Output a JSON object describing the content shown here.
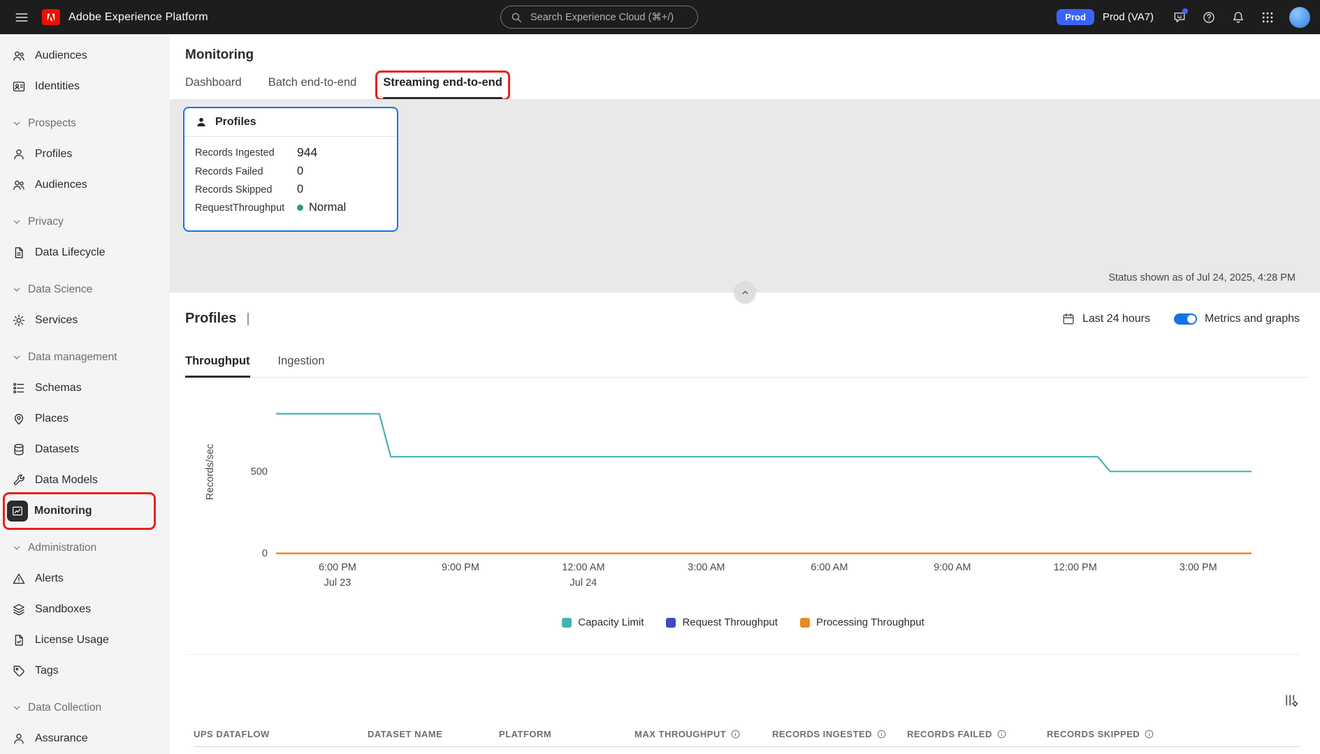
{
  "topbar": {
    "app_title": "Adobe Experience Platform",
    "search_placeholder": "Search Experience Cloud (⌘+/)",
    "env_badge": "Prod",
    "env_label": "Prod (VA7)",
    "icon_buttons": [
      {
        "icon": "feedback-icon",
        "dot": true
      },
      {
        "icon": "help-icon"
      },
      {
        "icon": "bell-icon"
      },
      {
        "icon": "apps-grid-icon"
      }
    ]
  },
  "colors": {
    "accent_blue": "#1473e6",
    "badge_blue": "#3b63fb",
    "annotation_red": "#e5231b",
    "status_green": "#2d9d78"
  },
  "sidebar": {
    "items": [
      {
        "label": "Audiences",
        "icon": "people-icon"
      },
      {
        "label": "Identities",
        "icon": "identity-icon"
      },
      {
        "label": "Prospects",
        "type": "section"
      },
      {
        "label": "Profiles",
        "icon": "person-icon"
      },
      {
        "label": "Audiences",
        "icon": "people-icon"
      },
      {
        "label": "Privacy",
        "type": "section"
      },
      {
        "label": "Data Lifecycle",
        "icon": "doc-lifecycle-icon"
      },
      {
        "label": "Data Science",
        "type": "section"
      },
      {
        "label": "Services",
        "icon": "services-icon"
      },
      {
        "label": "Data management",
        "type": "section"
      },
      {
        "label": "Schemas",
        "icon": "schemas-icon"
      },
      {
        "label": "Places",
        "icon": "location-pin-icon"
      },
      {
        "label": "Datasets",
        "icon": "database-icon"
      },
      {
        "label": "Data Models",
        "icon": "wrench-icon"
      },
      {
        "label": "Monitoring",
        "icon": "monitoring-chart-icon",
        "selected": true,
        "annotated": true
      },
      {
        "label": "Administration",
        "type": "section"
      },
      {
        "label": "Alerts",
        "icon": "warning-icon"
      },
      {
        "label": "Sandboxes",
        "icon": "layers-icon"
      },
      {
        "label": "License Usage",
        "icon": "license-doc-icon"
      },
      {
        "label": "Tags",
        "icon": "tag-icon"
      },
      {
        "label": "Data Collection",
        "type": "section"
      },
      {
        "label": "Assurance",
        "icon": "person-icon"
      }
    ]
  },
  "page": {
    "title": "Monitoring",
    "tabs": [
      {
        "label": "Dashboard"
      },
      {
        "label": "Batch end-to-end"
      },
      {
        "label": "Streaming end-to-end",
        "selected": true,
        "annotated": true
      }
    ],
    "status_text": "Status shown as of Jul 24, 2025, 4:28 PM"
  },
  "profiles_card": {
    "title": "Profiles",
    "rows": [
      {
        "label": "Records Ingested",
        "value": "944"
      },
      {
        "label": "Records Failed",
        "value": "0"
      },
      {
        "label": "Records Skipped",
        "value": "0"
      },
      {
        "label": "RequestThroughput",
        "value": "Normal",
        "dot": "#2d9d78"
      }
    ]
  },
  "metrics": {
    "title": "Profiles",
    "time_range": "Last 24 hours",
    "toggle_label": "Metrics and graphs",
    "toggle_on": true,
    "tabs": [
      {
        "label": "Throughput",
        "selected": true
      },
      {
        "label": "Ingestion"
      }
    ]
  },
  "chart_data": {
    "type": "line",
    "ylabel": "Records/sec",
    "yticks": [
      0,
      500
    ],
    "ylim": [
      0,
      995
    ],
    "xlim": [
      -1.5,
      22.3
    ],
    "x_unit": "hours from 6:00 PM Jul 23",
    "grid": false,
    "legend_position": "bottom",
    "x_ticks": [
      {
        "pos": 0,
        "label": "6:00 PM",
        "sub": "Jul 23"
      },
      {
        "pos": 3,
        "label": "9:00 PM"
      },
      {
        "pos": 6,
        "label": "12:00 AM",
        "sub": "Jul 24"
      },
      {
        "pos": 9,
        "label": "3:00 AM"
      },
      {
        "pos": 12,
        "label": "6:00 AM"
      },
      {
        "pos": 15,
        "label": "9:00 AM"
      },
      {
        "pos": 18,
        "label": "12:00 PM"
      },
      {
        "pos": 21,
        "label": "3:00 PM"
      }
    ],
    "series": [
      {
        "name": "Capacity Limit",
        "color": "#46b2ae",
        "width": 2.2,
        "points": [
          [
            -1.5,
            860
          ],
          [
            1.02,
            860
          ],
          [
            1.3,
            597
          ],
          [
            18.55,
            597
          ],
          [
            18.85,
            507
          ],
          [
            22.3,
            507
          ]
        ]
      },
      {
        "name": "Request Throughput",
        "color": "#3d47c9",
        "width": 2,
        "points": [
          [
            -1.5,
            6
          ],
          [
            22.3,
            6
          ]
        ]
      },
      {
        "name": "Processing Throughput",
        "color": "#ea8a1e",
        "width": 2.5,
        "points": [
          [
            -1.5,
            6
          ],
          [
            22.3,
            6
          ]
        ]
      }
    ]
  },
  "table": {
    "columns": [
      {
        "label": "UPS DATAFLOW"
      },
      {
        "label": "DATASET NAME"
      },
      {
        "label": "PLATFORM"
      },
      {
        "label": "MAX THROUGHPUT",
        "info": true
      },
      {
        "label": "RECORDS INGESTED",
        "info": true
      },
      {
        "label": "RECORDS FAILED",
        "info": true
      },
      {
        "label": "RECORDS SKIPPED",
        "info": true
      }
    ]
  }
}
